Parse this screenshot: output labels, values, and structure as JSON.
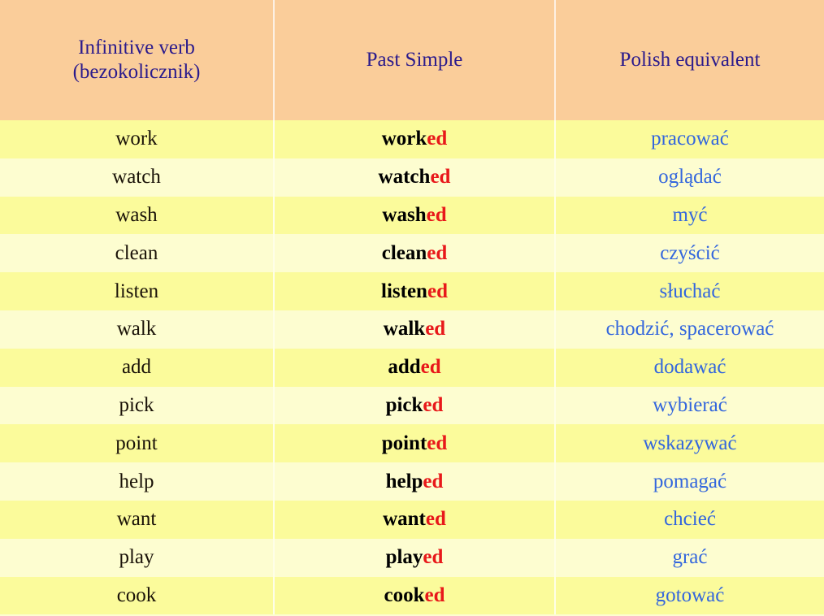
{
  "table": {
    "columns": [
      {
        "id": "infinitive",
        "lines": [
          "Infinitive verb",
          "(bezokolicznik)"
        ]
      },
      {
        "id": "past_simple",
        "lines": [
          "Past Simple"
        ]
      },
      {
        "id": "polish",
        "lines": [
          "Polish equivalent"
        ]
      }
    ],
    "past_suffix": "ed",
    "rows": [
      {
        "infinitive": "work",
        "past_stem": "work",
        "past_suffix": "ed",
        "past_full": "worked",
        "polish": "pracować"
      },
      {
        "infinitive": "watch",
        "past_stem": "watch",
        "past_suffix": "ed",
        "past_full": "watched",
        "polish": "oglądać"
      },
      {
        "infinitive": "wash",
        "past_stem": "wash",
        "past_suffix": "ed",
        "past_full": "washed",
        "polish": "myć"
      },
      {
        "infinitive": "clean",
        "past_stem": "clean",
        "past_suffix": "ed",
        "past_full": "cleaned",
        "polish": "czyścić"
      },
      {
        "infinitive": "listen",
        "past_stem": "listen",
        "past_suffix": "ed",
        "past_full": "listened",
        "polish": "słuchać"
      },
      {
        "infinitive": "walk",
        "past_stem": "walk",
        "past_suffix": "ed",
        "past_full": "walked",
        "polish": "chodzić, spacerować"
      },
      {
        "infinitive": "add",
        "past_stem": "add",
        "past_suffix": "ed",
        "past_full": "added",
        "polish": "dodawać"
      },
      {
        "infinitive": "pick",
        "past_stem": "pick",
        "past_suffix": "ed",
        "past_full": "picked",
        "polish": "wybierać"
      },
      {
        "infinitive": "point",
        "past_stem": "point",
        "past_suffix": "ed",
        "past_full": "pointed",
        "polish": "wskazywać"
      },
      {
        "infinitive": "help",
        "past_stem": "help",
        "past_suffix": "ed",
        "past_full": "helped",
        "polish": "pomagać"
      },
      {
        "infinitive": "want",
        "past_stem": "want",
        "past_suffix": "ed",
        "past_full": "wanted",
        "polish": "chcieć"
      },
      {
        "infinitive": "play",
        "past_stem": "play",
        "past_suffix": "ed",
        "past_full": "played",
        "polish": "grać"
      },
      {
        "infinitive": "cook",
        "past_stem": "cook",
        "past_suffix": "ed",
        "past_full": "cooked",
        "polish": "gotować"
      }
    ]
  },
  "colors": {
    "header_background": "#facd9a",
    "header_text": "#2a1a8c",
    "row_odd_background": "#fbfb9b",
    "row_even_background": "#fdfdd0",
    "infinitive_text": "#1a1208",
    "past_stem_text": "#000000",
    "past_suffix_text": "#e8181a",
    "polish_text": "#3366dd",
    "grid_line": "#fefee6"
  }
}
